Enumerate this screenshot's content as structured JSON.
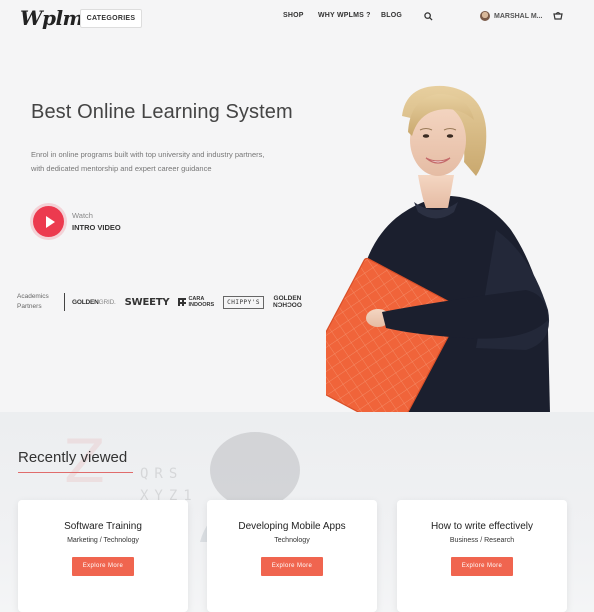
{
  "header": {
    "logo": "Wplms",
    "categories_label": "CATEGORIES",
    "nav": [
      "SHOP",
      "WHY WPLMS ?",
      "BLOG"
    ],
    "user_name": "MARSHAL M..."
  },
  "hero": {
    "title": "Best Online Learning System",
    "subtitle": "Enrol in online programs built with top university and industry partners, with dedicated mentorship and expert career guidance",
    "watch_label": "Watch",
    "watch_cta": "INTRO VIDEO"
  },
  "partners": {
    "label_line1": "Academics",
    "label_line2": "Partners",
    "logos": [
      {
        "a": "GOLDEN",
        "b": "GRID."
      },
      {
        "a": "SWEETY"
      },
      {
        "a": "CARA",
        "b": "INDOORS"
      },
      {
        "a": "CHIPPY'S"
      },
      {
        "a": "GOLDEN",
        "b": "NƆHƆOO"
      }
    ]
  },
  "recently_viewed": {
    "title": "Recently viewed",
    "cards": [
      {
        "title": "Software Training",
        "category": "Marketing / Technology",
        "button": "Explore More"
      },
      {
        "title": "Developing Mobile Apps",
        "category": "Technology",
        "button": "Explore More"
      },
      {
        "title": "How to write effectively",
        "category": "Business / Research",
        "button": "Explore More"
      }
    ]
  },
  "colors": {
    "accent": "#ec3a4f",
    "button": "#f0654f",
    "folder": "#f0643a"
  }
}
